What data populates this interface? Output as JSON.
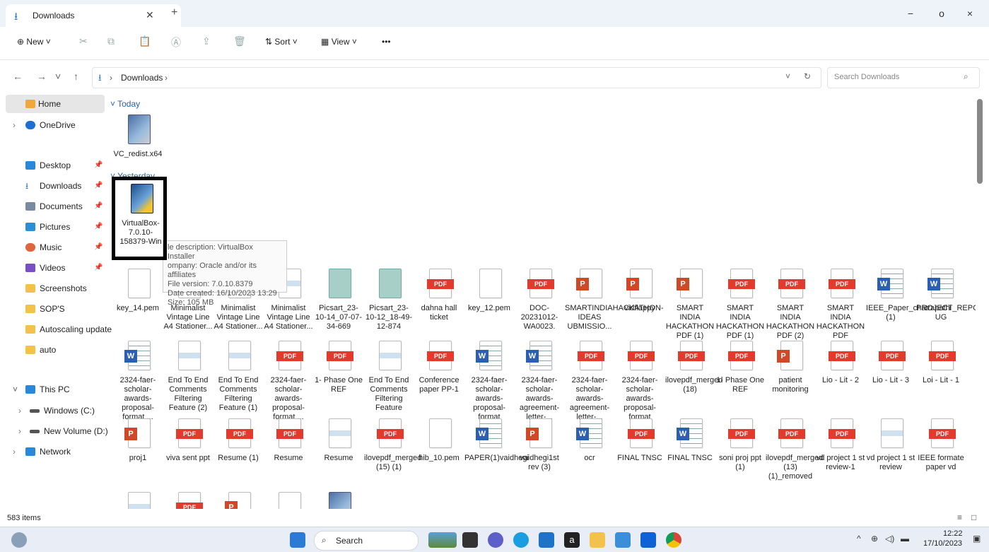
{
  "window": {
    "tab_title": "Downloads",
    "new_tab": "+",
    "minimize": "−",
    "maximize": "o",
    "close": "×"
  },
  "toolbar": {
    "new_label": "New",
    "sort_label": "Sort",
    "view_label": "View",
    "more_label": "•••"
  },
  "address": {
    "path": "Downloads",
    "search_placeholder": "Search Downloads"
  },
  "sidebar": {
    "home": "Home",
    "onedrive": "OneDrive",
    "desktop": "Desktop",
    "downloads": "Downloads",
    "documents": "Documents",
    "pictures": "Pictures",
    "music": "Music",
    "videos": "Videos",
    "screenshots": "Screenshots",
    "sops": "SOP'S",
    "autoscaling": "Autoscaling update",
    "auto": "auto",
    "thispc": "This PC",
    "windows": "Windows (C:)",
    "newvolume": "New Volume (D:)",
    "network": "Network"
  },
  "groups": {
    "today": "Today",
    "yesterday": "Yesterday"
  },
  "files": {
    "vcredist": "VC_redist.x64",
    "virtualbox": "VirtualBox-7.0.10-158379-Win",
    "row1": [
      "key_14.pem",
      "Minimalist Vintage Line A4 Stationer...",
      "Minimalist Vintage Line A4 Stationer...",
      "Minimalist Vintage Line A4 Stationer...",
      "Picsart_23-10-14_07-07-34-669",
      "Picsart_23-10-12_18-49-12-874",
      "dahna hall ticket",
      "key_12.pem",
      "DOC-20231012-WA0023.",
      "SMARTINDIAHACKATHON-IDEAS UBMISSIO...",
      "vidflappy",
      "SMART INDIA HACKATHON PDF (1)",
      "SMART INDIA HACKATHON PDF (1)",
      "SMART INDIA HACKATHON PDF (2)",
      "SMART INDIA HACKATHON PDF",
      "IEEE_Paper_chatrapathi (1)",
      "PROJECT_REPORT-UG"
    ],
    "row2": [
      "2324-faer-scholar-awards-proposal-format ...",
      "End To End Comments Filtering Feature (2)",
      "End To End Comments Filtering Feature (1)",
      "2324-faer-scholar-awards-proposal-format ...",
      "1- Phase One REF",
      "End To End Comments Filtering Feature",
      "Conference paper PP-1",
      "2324-faer-scholar-awards-proposal-format",
      "2324-faer-scholar-awards-agreement-letter-...",
      "2324-faer-scholar-awards-agreement-letter-...",
      "2324-faer-scholar-awards-proposal-format",
      "ilovepdf_merged (18)",
      "1- Phase One REF",
      "patient monitoring",
      "Lio - Lit - 2",
      "Lio - Lit - 3",
      "Loi - Lit - 1"
    ],
    "row3": [
      "proj1",
      "viva sent ppt",
      "Resume (1)",
      "Resume",
      "Resume",
      "ilovepdf_merged (15) (1)",
      "hib_10.pem",
      "PAPER(1)vaidhegi",
      "vaidhegi1st rev (3)",
      "ocr",
      "FINAL TNSC",
      "FINAL TNSC",
      "soni proj ppt (1)",
      "ilovepdf_merged (13) (1)_removed",
      "vd project 1 st review-1",
      "vd project 1 st review",
      "IEEE formate paper vd"
    ]
  },
  "tooltip": {
    "line1": "le description: VirtualBox Installer",
    "line2": "ompany: Oracle and/or its affiliates",
    "line3": "File version: 7.0.10.8379",
    "line4": "Date created: 16/10/2023 13:29",
    "line5": "Size: 105 MB"
  },
  "status": {
    "items": "583 items"
  },
  "taskbar": {
    "search": "Search",
    "time": "12:22",
    "date": "17/10/2023"
  }
}
